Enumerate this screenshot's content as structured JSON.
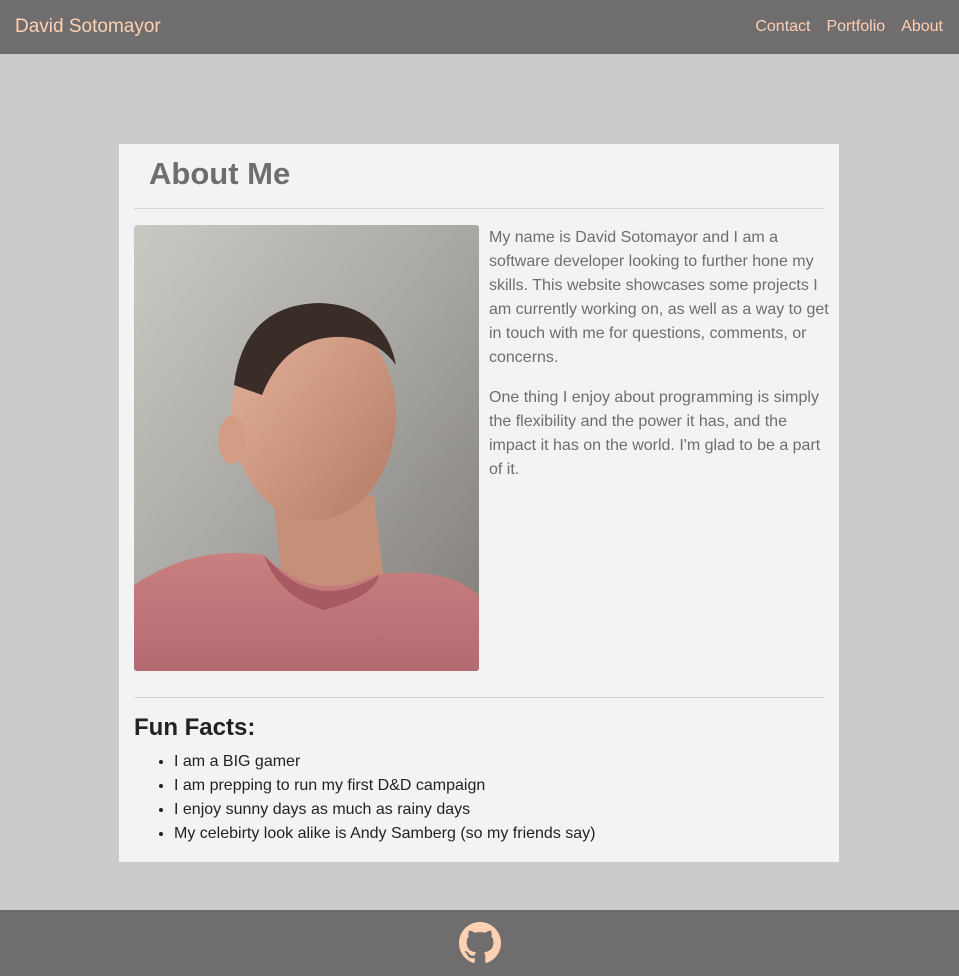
{
  "navbar": {
    "brand": "David Sotomayor",
    "links": [
      "Contact",
      "Portfolio",
      "About"
    ]
  },
  "card": {
    "title": "About Me",
    "bio": [
      "My name is David Sotomayor and I am a software developer looking to further hone my skills. This website showcases some projects I am currently working on, as well as a way to get in touch with me for questions, comments, or concerns.",
      "One thing I enjoy about programming is simply the flexibility and the power it has, and the impact it has on the world. I'm glad to be a part of it."
    ],
    "fun_facts_title": "Fun Facts:",
    "fun_facts": [
      "I am a BIG gamer",
      "I am prepping to run my first D&D campaign",
      "I enjoy sunny days as much as rainy days",
      "My celebirty look alike is Andy Samberg (so my friends say)"
    ]
  },
  "footer": {
    "icon": "github-icon"
  },
  "colors": {
    "navbar_bg": "#6f6d6e",
    "accent": "#ffd1b3",
    "page_bg": "#cbcbcb",
    "card_bg": "#f3f3f3"
  }
}
